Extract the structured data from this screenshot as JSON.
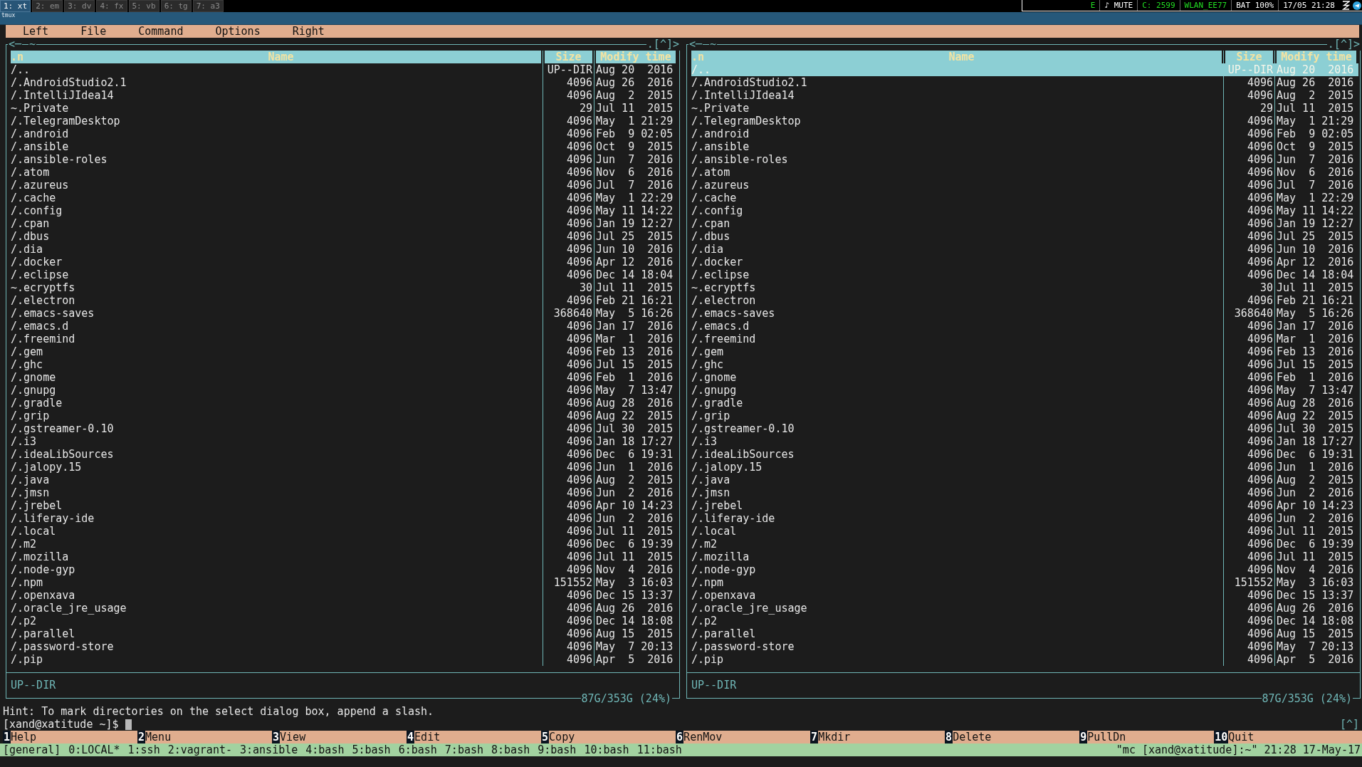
{
  "tabs": [
    {
      "label": "1: xt",
      "selected": true
    },
    {
      "label": "2: em",
      "selected": false
    },
    {
      "label": "3: dv",
      "selected": false
    },
    {
      "label": "4: fx",
      "selected": false
    },
    {
      "label": "5: vb",
      "selected": false
    },
    {
      "label": "6: tg",
      "selected": false
    },
    {
      "label": "7: a3",
      "selected": false
    }
  ],
  "status_items": [
    {
      "text": "E",
      "color": "#22dd22"
    },
    {
      "text": "♪ MUTE",
      "color": "#ffffff"
    },
    {
      "text": "C: 2599",
      "color": "#22dd22"
    },
    {
      "text": "WLAN_EE77",
      "color": "#22dd22"
    },
    {
      "text": "BAT 100%",
      "color": "#ffffff"
    },
    {
      "text": "17/05 21:28",
      "color": "#ffffff"
    }
  ],
  "tmux_title": "tmux",
  "menu": [
    "Left",
    "File",
    "Command",
    "Options",
    "Right"
  ],
  "panels": [
    {
      "back": "<─",
      "path": "~",
      "controls": ".[^]>",
      "sort_indicator": ".n",
      "columns": [
        "Name",
        "Size",
        "Modify time"
      ],
      "mini_status": "UP--DIR",
      "free_space": "87G/353G (24%)",
      "rows": [
        {
          "name": "/..",
          "size": "UP--DIR",
          "modified": "Aug 20  2016",
          "selected": false
        },
        {
          "name": "/.AndroidStudio2.1",
          "size": "4096",
          "modified": "Aug 26  2016",
          "selected": false
        },
        {
          "name": "/.IntelliJIdea14",
          "size": "4096",
          "modified": "Aug  2  2015",
          "selected": false
        },
        {
          "name": "~.Private",
          "size": "29",
          "modified": "Jul 11  2015",
          "selected": false
        },
        {
          "name": "/.TelegramDesktop",
          "size": "4096",
          "modified": "May  1 21:29",
          "selected": false
        },
        {
          "name": "/.android",
          "size": "4096",
          "modified": "Feb  9 02:05",
          "selected": false
        },
        {
          "name": "/.ansible",
          "size": "4096",
          "modified": "Oct  9  2015",
          "selected": false
        },
        {
          "name": "/.ansible-roles",
          "size": "4096",
          "modified": "Jun  7  2016",
          "selected": false
        },
        {
          "name": "/.atom",
          "size": "4096",
          "modified": "Nov  6  2016",
          "selected": false
        },
        {
          "name": "/.azureus",
          "size": "4096",
          "modified": "Jul  7  2016",
          "selected": false
        },
        {
          "name": "/.cache",
          "size": "4096",
          "modified": "May  1 22:29",
          "selected": false
        },
        {
          "name": "/.config",
          "size": "4096",
          "modified": "May 11 14:22",
          "selected": false
        },
        {
          "name": "/.cpan",
          "size": "4096",
          "modified": "Jan 19 12:27",
          "selected": false
        },
        {
          "name": "/.dbus",
          "size": "4096",
          "modified": "Jul 25  2015",
          "selected": false
        },
        {
          "name": "/.dia",
          "size": "4096",
          "modified": "Jun 10  2016",
          "selected": false
        },
        {
          "name": "/.docker",
          "size": "4096",
          "modified": "Apr 12  2016",
          "selected": false
        },
        {
          "name": "/.eclipse",
          "size": "4096",
          "modified": "Dec 14 18:04",
          "selected": false
        },
        {
          "name": "~.ecryptfs",
          "size": "30",
          "modified": "Jul 11  2015",
          "selected": false
        },
        {
          "name": "/.electron",
          "size": "4096",
          "modified": "Feb 21 16:21",
          "selected": false
        },
        {
          "name": "/.emacs-saves",
          "size": "368640",
          "modified": "May  5 16:26",
          "selected": false
        },
        {
          "name": "/.emacs.d",
          "size": "4096",
          "modified": "Jan 17  2016",
          "selected": false
        },
        {
          "name": "/.freemind",
          "size": "4096",
          "modified": "Mar  1  2016",
          "selected": false
        },
        {
          "name": "/.gem",
          "size": "4096",
          "modified": "Feb 13  2016",
          "selected": false
        },
        {
          "name": "/.ghc",
          "size": "4096",
          "modified": "Jul 15  2015",
          "selected": false
        },
        {
          "name": "/.gnome",
          "size": "4096",
          "modified": "Feb  1  2016",
          "selected": false
        },
        {
          "name": "/.gnupg",
          "size": "4096",
          "modified": "May  7 13:47",
          "selected": false
        },
        {
          "name": "/.gradle",
          "size": "4096",
          "modified": "Aug 28  2016",
          "selected": false
        },
        {
          "name": "/.grip",
          "size": "4096",
          "modified": "Aug 22  2015",
          "selected": false
        },
        {
          "name": "/.gstreamer-0.10",
          "size": "4096",
          "modified": "Jul 30  2015",
          "selected": false
        },
        {
          "name": "/.i3",
          "size": "4096",
          "modified": "Jan 18 17:27",
          "selected": false
        },
        {
          "name": "/.ideaLibSources",
          "size": "4096",
          "modified": "Dec  6 19:31",
          "selected": false
        },
        {
          "name": "/.jalopy.15",
          "size": "4096",
          "modified": "Jun  1  2016",
          "selected": false
        },
        {
          "name": "/.java",
          "size": "4096",
          "modified": "Aug  2  2015",
          "selected": false
        },
        {
          "name": "/.jmsn",
          "size": "4096",
          "modified": "Jun  2  2016",
          "selected": false
        },
        {
          "name": "/.jrebel",
          "size": "4096",
          "modified": "Apr 10 14:23",
          "selected": false
        },
        {
          "name": "/.liferay-ide",
          "size": "4096",
          "modified": "Jun  2  2016",
          "selected": false
        },
        {
          "name": "/.local",
          "size": "4096",
          "modified": "Jul 11  2015",
          "selected": false
        },
        {
          "name": "/.m2",
          "size": "4096",
          "modified": "Dec  6 19:39",
          "selected": false
        },
        {
          "name": "/.mozilla",
          "size": "4096",
          "modified": "Jul 11  2015",
          "selected": false
        },
        {
          "name": "/.node-gyp",
          "size": "4096",
          "modified": "Nov  4  2016",
          "selected": false
        },
        {
          "name": "/.npm",
          "size": "151552",
          "modified": "May  3 16:03",
          "selected": false
        },
        {
          "name": "/.openxava",
          "size": "4096",
          "modified": "Dec 15 13:37",
          "selected": false
        },
        {
          "name": "/.oracle_jre_usage",
          "size": "4096",
          "modified": "Aug 26  2016",
          "selected": false
        },
        {
          "name": "/.p2",
          "size": "4096",
          "modified": "Dec 14 18:08",
          "selected": false
        },
        {
          "name": "/.parallel",
          "size": "4096",
          "modified": "Aug 15  2015",
          "selected": false
        },
        {
          "name": "/.password-store",
          "size": "4096",
          "modified": "May  7 20:13",
          "selected": false
        },
        {
          "name": "/.pip",
          "size": "4096",
          "modified": "Apr  5  2016",
          "selected": false
        }
      ]
    },
    {
      "back": "<─",
      "path": "~",
      "controls": ".[^]>",
      "sort_indicator": ".n",
      "columns": [
        "Name",
        "Size",
        "Modify time"
      ],
      "mini_status": "UP--DIR",
      "free_space": "87G/353G (24%)",
      "rows": [
        {
          "name": "/..",
          "size": "UP--DIR",
          "modified": "Aug 20  2016",
          "selected": true
        },
        {
          "name": "/.AndroidStudio2.1",
          "size": "4096",
          "modified": "Aug 26  2016",
          "selected": false
        },
        {
          "name": "/.IntelliJIdea14",
          "size": "4096",
          "modified": "Aug  2  2015",
          "selected": false
        },
        {
          "name": "~.Private",
          "size": "29",
          "modified": "Jul 11  2015",
          "selected": false
        },
        {
          "name": "/.TelegramDesktop",
          "size": "4096",
          "modified": "May  1 21:29",
          "selected": false
        },
        {
          "name": "/.android",
          "size": "4096",
          "modified": "Feb  9 02:05",
          "selected": false
        },
        {
          "name": "/.ansible",
          "size": "4096",
          "modified": "Oct  9  2015",
          "selected": false
        },
        {
          "name": "/.ansible-roles",
          "size": "4096",
          "modified": "Jun  7  2016",
          "selected": false
        },
        {
          "name": "/.atom",
          "size": "4096",
          "modified": "Nov  6  2016",
          "selected": false
        },
        {
          "name": "/.azureus",
          "size": "4096",
          "modified": "Jul  7  2016",
          "selected": false
        },
        {
          "name": "/.cache",
          "size": "4096",
          "modified": "May  1 22:29",
          "selected": false
        },
        {
          "name": "/.config",
          "size": "4096",
          "modified": "May 11 14:22",
          "selected": false
        },
        {
          "name": "/.cpan",
          "size": "4096",
          "modified": "Jan 19 12:27",
          "selected": false
        },
        {
          "name": "/.dbus",
          "size": "4096",
          "modified": "Jul 25  2015",
          "selected": false
        },
        {
          "name": "/.dia",
          "size": "4096",
          "modified": "Jun 10  2016",
          "selected": false
        },
        {
          "name": "/.docker",
          "size": "4096",
          "modified": "Apr 12  2016",
          "selected": false
        },
        {
          "name": "/.eclipse",
          "size": "4096",
          "modified": "Dec 14 18:04",
          "selected": false
        },
        {
          "name": "~.ecryptfs",
          "size": "30",
          "modified": "Jul 11  2015",
          "selected": false
        },
        {
          "name": "/.electron",
          "size": "4096",
          "modified": "Feb 21 16:21",
          "selected": false
        },
        {
          "name": "/.emacs-saves",
          "size": "368640",
          "modified": "May  5 16:26",
          "selected": false
        },
        {
          "name": "/.emacs.d",
          "size": "4096",
          "modified": "Jan 17  2016",
          "selected": false
        },
        {
          "name": "/.freemind",
          "size": "4096",
          "modified": "Mar  1  2016",
          "selected": false
        },
        {
          "name": "/.gem",
          "size": "4096",
          "modified": "Feb 13  2016",
          "selected": false
        },
        {
          "name": "/.ghc",
          "size": "4096",
          "modified": "Jul 15  2015",
          "selected": false
        },
        {
          "name": "/.gnome",
          "size": "4096",
          "modified": "Feb  1  2016",
          "selected": false
        },
        {
          "name": "/.gnupg",
          "size": "4096",
          "modified": "May  7 13:47",
          "selected": false
        },
        {
          "name": "/.gradle",
          "size": "4096",
          "modified": "Aug 28  2016",
          "selected": false
        },
        {
          "name": "/.grip",
          "size": "4096",
          "modified": "Aug 22  2015",
          "selected": false
        },
        {
          "name": "/.gstreamer-0.10",
          "size": "4096",
          "modified": "Jul 30  2015",
          "selected": false
        },
        {
          "name": "/.i3",
          "size": "4096",
          "modified": "Jan 18 17:27",
          "selected": false
        },
        {
          "name": "/.ideaLibSources",
          "size": "4096",
          "modified": "Dec  6 19:31",
          "selected": false
        },
        {
          "name": "/.jalopy.15",
          "size": "4096",
          "modified": "Jun  1  2016",
          "selected": false
        },
        {
          "name": "/.java",
          "size": "4096",
          "modified": "Aug  2  2015",
          "selected": false
        },
        {
          "name": "/.jmsn",
          "size": "4096",
          "modified": "Jun  2  2016",
          "selected": false
        },
        {
          "name": "/.jrebel",
          "size": "4096",
          "modified": "Apr 10 14:23",
          "selected": false
        },
        {
          "name": "/.liferay-ide",
          "size": "4096",
          "modified": "Jun  2  2016",
          "selected": false
        },
        {
          "name": "/.local",
          "size": "4096",
          "modified": "Jul 11  2015",
          "selected": false
        },
        {
          "name": "/.m2",
          "size": "4096",
          "modified": "Dec  6 19:39",
          "selected": false
        },
        {
          "name": "/.mozilla",
          "size": "4096",
          "modified": "Jul 11  2015",
          "selected": false
        },
        {
          "name": "/.node-gyp",
          "size": "4096",
          "modified": "Nov  4  2016",
          "selected": false
        },
        {
          "name": "/.npm",
          "size": "151552",
          "modified": "May  3 16:03",
          "selected": false
        },
        {
          "name": "/.openxava",
          "size": "4096",
          "modified": "Dec 15 13:37",
          "selected": false
        },
        {
          "name": "/.oracle_jre_usage",
          "size": "4096",
          "modified": "Aug 26  2016",
          "selected": false
        },
        {
          "name": "/.p2",
          "size": "4096",
          "modified": "Dec 14 18:08",
          "selected": false
        },
        {
          "name": "/.parallel",
          "size": "4096",
          "modified": "Aug 15  2015",
          "selected": false
        },
        {
          "name": "/.password-store",
          "size": "4096",
          "modified": "May  7 20:13",
          "selected": false
        },
        {
          "name": "/.pip",
          "size": "4096",
          "modified": "Apr  5  2016",
          "selected": false
        }
      ]
    }
  ],
  "hint": "Hint: To mark directories on the select dialog box, append a slash.",
  "prompt": "[xand@xatitude ~]$ ",
  "history_button": "[^]",
  "function_keys": [
    {
      "number": "1",
      "label": "Help"
    },
    {
      "number": "2",
      "label": "Menu"
    },
    {
      "number": "3",
      "label": "View"
    },
    {
      "number": "4",
      "label": "Edit"
    },
    {
      "number": "5",
      "label": "Copy"
    },
    {
      "number": "6",
      "label": "RenMov"
    },
    {
      "number": "7",
      "label": "Mkdir"
    },
    {
      "number": "8",
      "label": "Delete"
    },
    {
      "number": "9",
      "label": "PullDn"
    },
    {
      "number": "10",
      "label": "Quit"
    }
  ],
  "tmux_status": {
    "session": "[general]",
    "windows": [
      "0:LOCAL*",
      "1:ssh",
      "2:vagrant-",
      "3:ansible",
      "4:bash",
      "5:bash",
      "6:bash",
      "7:bash",
      "8:bash",
      "9:bash",
      "10:bash",
      "11:bash"
    ],
    "right": "\"mc [xand@xatitude]:~\" 21:28 17-May-17"
  }
}
